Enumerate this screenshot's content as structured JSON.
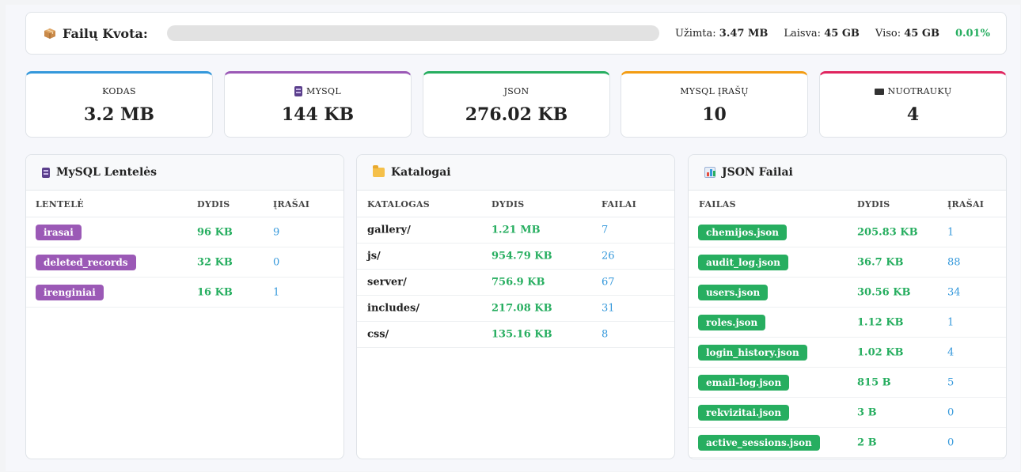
{
  "quota": {
    "title": "Failų Kvota:",
    "used_label": "Užimta:",
    "used_value": "3.47 MB",
    "free_label": "Laisva:",
    "free_value": "45 GB",
    "total_label": "Viso:",
    "total_value": "45 GB",
    "percent": "0.01%",
    "fill_fraction": 0.0001
  },
  "cards": [
    {
      "label": "KODAS",
      "value": "3.2 MB",
      "color": "#3498db"
    },
    {
      "label": "MYSQL",
      "value": "144 KB",
      "color": "#9b59b6",
      "icon": "database-icon"
    },
    {
      "label": "JSON",
      "value": "276.02 KB",
      "color": "#27ae60"
    },
    {
      "label": "MYSQL ĮRAŠŲ",
      "value": "10",
      "color": "#f39c12"
    },
    {
      "label": "NUOTRAUKŲ",
      "value": "4",
      "color": "#e0245e",
      "icon": "film-icon"
    }
  ],
  "mysql": {
    "title": "MySQL Lentelės",
    "headers": [
      "LENTELĖ",
      "DYDIS",
      "ĮRAŠAI"
    ],
    "rows": [
      {
        "name": "irasai",
        "size": "96 KB",
        "count": "9"
      },
      {
        "name": "deleted_records",
        "size": "32 KB",
        "count": "0"
      },
      {
        "name": "irenginiai",
        "size": "16 KB",
        "count": "1"
      }
    ]
  },
  "dirs": {
    "title": "Katalogai",
    "headers": [
      "KATALOGAS",
      "DYDIS",
      "FAILAI"
    ],
    "rows": [
      {
        "name": "gallery/",
        "size": "1.21 MB",
        "count": "7"
      },
      {
        "name": "js/",
        "size": "954.79 KB",
        "count": "26"
      },
      {
        "name": "server/",
        "size": "756.9 KB",
        "count": "67"
      },
      {
        "name": "includes/",
        "size": "217.08 KB",
        "count": "31"
      },
      {
        "name": "css/",
        "size": "135.16 KB",
        "count": "8"
      }
    ]
  },
  "json": {
    "title": "JSON Failai",
    "headers": [
      "FAILAS",
      "DYDIS",
      "ĮRAŠAI"
    ],
    "rows": [
      {
        "name": "chemijos.json",
        "size": "205.83 KB",
        "count": "1"
      },
      {
        "name": "audit_log.json",
        "size": "36.7 KB",
        "count": "88"
      },
      {
        "name": "users.json",
        "size": "30.56 KB",
        "count": "34"
      },
      {
        "name": "roles.json",
        "size": "1.12 KB",
        "count": "1"
      },
      {
        "name": "login_history.json",
        "size": "1.02 KB",
        "count": "4"
      },
      {
        "name": "email-log.json",
        "size": "815 B",
        "count": "5"
      },
      {
        "name": "rekvizitai.json",
        "size": "3 B",
        "count": "0"
      },
      {
        "name": "active_sessions.json",
        "size": "2 B",
        "count": "0"
      }
    ]
  },
  "colors": {
    "green": "#27ae60",
    "blue": "#3498db",
    "purple": "#9b59b6"
  }
}
